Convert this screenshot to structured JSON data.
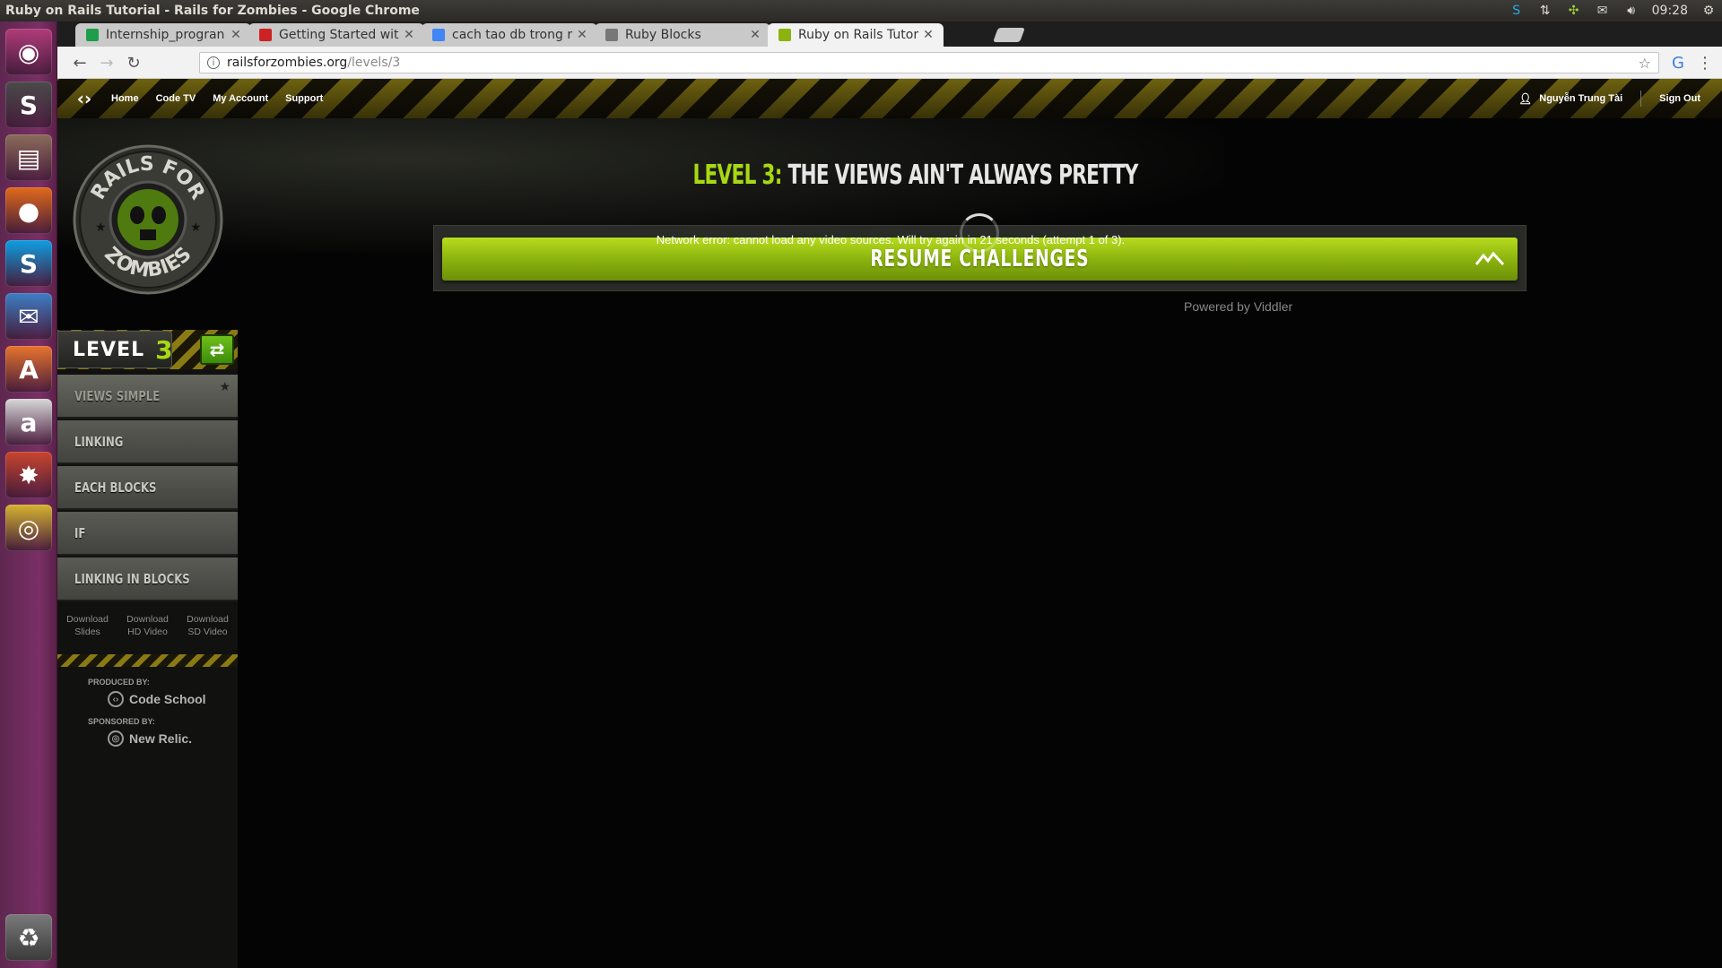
{
  "system": {
    "window_title": "Ruby on Rails Tutorial - Rails for Zombies - Google Chrome",
    "clock": "09:28"
  },
  "launcher": {
    "items": [
      {
        "name": "ubuntu-dash-icon",
        "glyph": "◉",
        "color": "#b03c7a"
      },
      {
        "name": "sublime-text-icon",
        "glyph": "S",
        "color": "#4a4a4a"
      },
      {
        "name": "files-icon",
        "glyph": "▤",
        "color": "#8a6c5a"
      },
      {
        "name": "firefox-icon",
        "glyph": "●",
        "color": "#e06a1a"
      },
      {
        "name": "skype-icon",
        "glyph": "S",
        "color": "#0d9ee2"
      },
      {
        "name": "thunderbird-icon",
        "glyph": "✉",
        "color": "#3d7ec4"
      },
      {
        "name": "software-center-icon",
        "glyph": "A",
        "color": "#e7742e"
      },
      {
        "name": "amazon-icon",
        "glyph": "a",
        "color": "#d8d8d8"
      },
      {
        "name": "system-settings-icon",
        "glyph": "✸",
        "color": "#c8452e"
      },
      {
        "name": "chrome-icon",
        "glyph": "◎",
        "color": "#d5b330"
      }
    ],
    "trash": {
      "name": "trash-icon",
      "glyph": "♻"
    }
  },
  "browser": {
    "tabs": [
      {
        "title": "Internship_progran",
        "favicon_color": "#1e9e4a",
        "active": false
      },
      {
        "title": "Getting Started wit",
        "favicon_color": "#cc2222",
        "active": false
      },
      {
        "title": "cach tao db trong r",
        "favicon_color": "#4285f4",
        "active": false
      },
      {
        "title": "Ruby Blocks",
        "favicon_color": "#777777",
        "active": false
      },
      {
        "title": "Ruby on Rails Tutor",
        "favicon_color": "#8cb40e",
        "active": true
      }
    ],
    "url_host": "railsforzombies.org",
    "url_path": "/levels/3"
  },
  "site": {
    "nav": [
      "Home",
      "Code TV",
      "My Account",
      "Support"
    ],
    "user_name": "Nguyễn Trung Tài",
    "sign_out": "Sign Out",
    "badge_top": "RAILS FOR",
    "badge_bottom": "ZOMBIES",
    "level_prefix": "LEVEL 3:",
    "level_name": "THE VIEWS AIN'T ALWAYS PRETTY",
    "resume_label": "RESUME CHALLENGES",
    "error_message": "Network error: cannot load any video sources. Will try again in 21 seconds (attempt 1 of 3).",
    "powered_by": "Powered by Viddler"
  },
  "sidebar": {
    "level_word": "LEVEL",
    "level_number": "3",
    "chapters": [
      "VIEWS SIMPLE",
      "LINKING",
      "EACH BLOCKS",
      "IF",
      "LINKING IN BLOCKS"
    ],
    "downloads": [
      {
        "line1": "Download",
        "line2": "Slides"
      },
      {
        "line1": "Download",
        "line2": "HD Video"
      },
      {
        "line1": "Download",
        "line2": "SD Video"
      }
    ],
    "produced_label": "PRODUCED BY:",
    "produced_brand": "Code School",
    "sponsored_label": "SPONSORED BY:",
    "sponsored_brand": "New Relic."
  },
  "colors": {
    "accent_green": "#a8d814",
    "hazard_yellow": "#8a7a14",
    "launcher_purple": "#7a2f66"
  }
}
